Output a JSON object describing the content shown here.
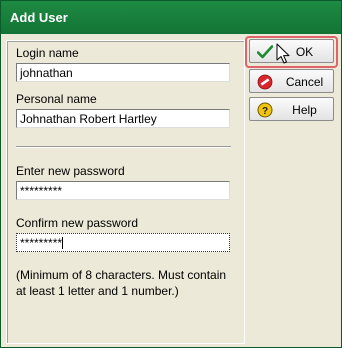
{
  "window": {
    "title": "Add User"
  },
  "form": {
    "login_label": "Login name",
    "login_value": "johnathan",
    "personal_label": "Personal name",
    "personal_value": "Johnathan Robert Hartley",
    "new_password_label": "Enter new password",
    "new_password_value": "*********",
    "confirm_password_label": "Confirm new password",
    "confirm_password_value": "*********",
    "hint_line1": "(Minimum of 8 characters. Must contain",
    "hint_line2": "at least 1 letter and 1 number.)"
  },
  "buttons": {
    "ok": {
      "label": "OK",
      "icon": "checkmark-icon"
    },
    "cancel": {
      "label": "Cancel",
      "icon": "no-entry-icon"
    },
    "help": {
      "label": "Help",
      "icon": "question-icon"
    }
  },
  "colors": {
    "titlebar": "#1e8a44",
    "highlight": "#e0626b",
    "check": "#1f8a2f",
    "cancel_red": "#d8262c",
    "help_yellow": "#f1c40f"
  }
}
